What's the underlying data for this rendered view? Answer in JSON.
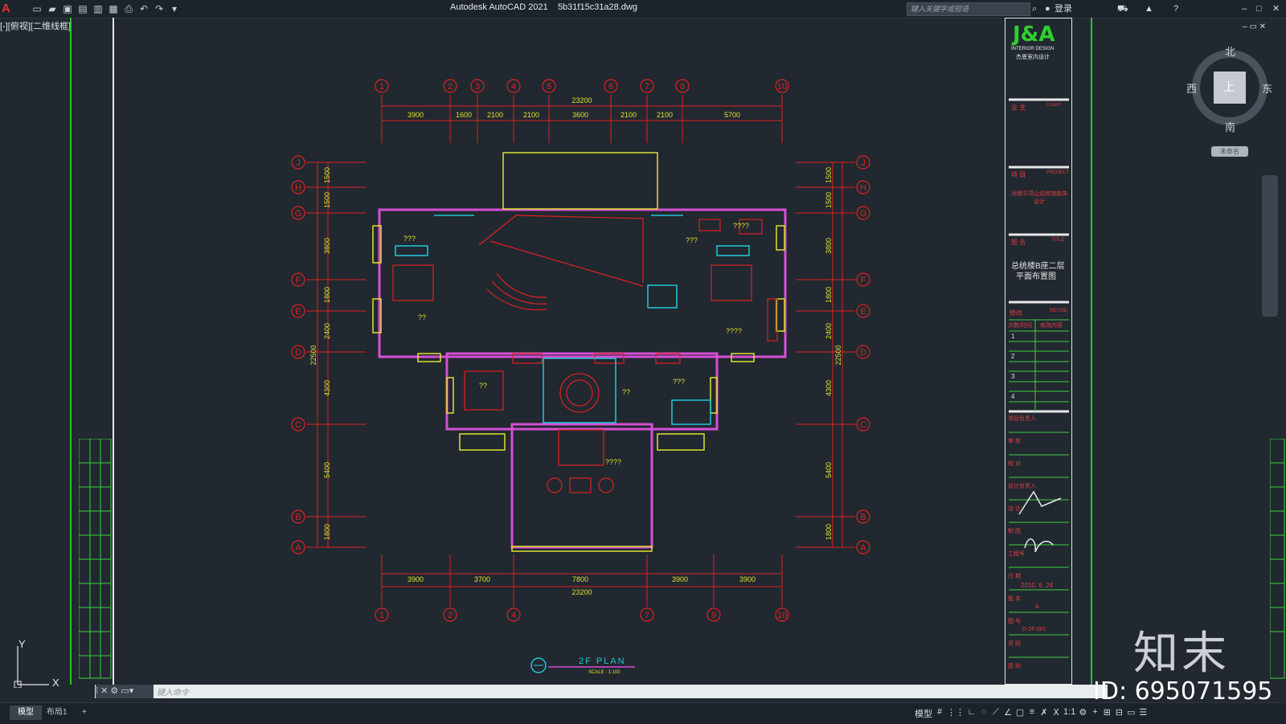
{
  "window": {
    "app_title": "Autodesk AutoCAD 2021",
    "file_name": "5b31f15c31a28.dwg",
    "search_placeholder": "键入关键字或短语",
    "login_label": "登录"
  },
  "viewport": {
    "view_label": "[-][俯视][二维线框]"
  },
  "drawing": {
    "top_grid": [
      "1",
      "2",
      "3",
      "4",
      "5",
      "6",
      "7",
      "8",
      "10"
    ],
    "bottom_grid": [
      "1",
      "2",
      "4",
      "7",
      "9",
      "10"
    ],
    "side_grid": [
      "J",
      "H",
      "G",
      "F",
      "E",
      "D",
      "C",
      "B",
      "A"
    ],
    "top_total": "23200",
    "top_dims": [
      "3900",
      "1600",
      "2100",
      "2100",
      "3600",
      "2100",
      "2100",
      "5700"
    ],
    "bottom_total": "23200",
    "bottom_dims": [
      "3900",
      "3700",
      "7800",
      "3900",
      "3900"
    ],
    "left_total": "22500",
    "side_dims": [
      "1500",
      "1500",
      "3800",
      "1800",
      "2400",
      "4300",
      "5400",
      "1800"
    ],
    "room_labels": [
      "???",
      "??",
      "??",
      "????",
      "????",
      "???",
      "??",
      "???",
      "????"
    ],
    "plan_title": "2F PLAN",
    "plan_scale": "SCALE : 1:100"
  },
  "title_block": {
    "logo": "J&A",
    "logo_sub": "INTERIOR DESIGN",
    "logo_cn": "杰恩室内设计",
    "client_label": "业 主",
    "client_en": "CLIENT",
    "project_label": "项 目",
    "project_en": "PROJECT",
    "project_value": "河南平顶山迎宾馆装饰设计",
    "title_label": "图 名",
    "title_en": "TITLE",
    "title_value_1": "总统楼B座二层",
    "title_value_2": "平面布置图",
    "revise_label": "修改",
    "revise_en": "REVISE",
    "revise_cols": [
      "次数/时间",
      "修改内容"
    ],
    "revise_rows": [
      "1",
      "2",
      "3",
      "4"
    ],
    "director_label": "项目负责人",
    "approved_label": "审 核",
    "checked_label": "校 对",
    "designer_label": "设计负责人",
    "design_label": "设 计",
    "drawn_label": "制 图",
    "project_no_label": "工程号",
    "date_label": "日 期",
    "date_value": "2010. 6. 24",
    "version_label": "版 本",
    "version_value": "A",
    "drawing_no_label": "图 号",
    "drawing_no_value": "D-2F-001",
    "page_label": "页 码",
    "category_label": "图 别"
  },
  "viewcube": {
    "north": "北",
    "south": "南",
    "east": "东",
    "west": "西",
    "face": "上",
    "wcs": "未命名"
  },
  "ucs": {
    "x": "X",
    "y": "Y"
  },
  "command": {
    "placeholder": "键入命令"
  },
  "status": {
    "tab_model": "模型",
    "tab_layout1": "布局1",
    "tab_add": "+",
    "model_toggle": "模型",
    "scale": "1:1"
  },
  "watermark": {
    "brand": "知末",
    "id": "ID: 695071595"
  },
  "colors": {
    "background": "#212830",
    "grid_red": "#e02020",
    "wall_magenta": "#d64fd6",
    "furniture_yellow": "#e0e030",
    "cyan": "#20c8d8",
    "green": "#3ed03e"
  }
}
